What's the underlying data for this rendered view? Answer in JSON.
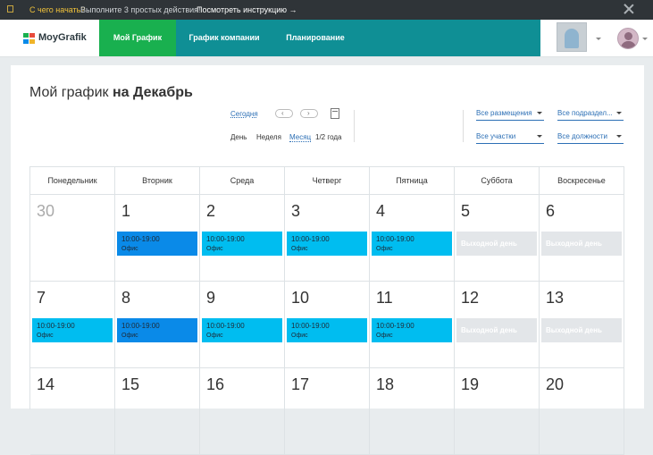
{
  "topbar": {
    "link": "С чего начать?",
    "text": "Выполните 3 простых действия!",
    "howto": "Посмотреть инструкцию →"
  },
  "navbar": {
    "logo": "MoyGrafik",
    "tabs": [
      {
        "label": "Мой График",
        "active": true
      },
      {
        "label": "График компании",
        "active": false
      },
      {
        "label": "Планирование",
        "active": false
      }
    ]
  },
  "page": {
    "title_prefix": "Мой график ",
    "title_month": "на Декабрь"
  },
  "controls": {
    "today": "Сегодня",
    "prev": "‹",
    "next": "›",
    "views": [
      {
        "label": "День",
        "active": false
      },
      {
        "label": "Неделя",
        "active": false
      },
      {
        "label": "Месяц",
        "active": true
      },
      {
        "label": "1/2 года",
        "active": false
      }
    ]
  },
  "filters": {
    "placements": "Все размещения",
    "departments": "Все подраздел...",
    "participants": "Все участки",
    "positions": "Все должности"
  },
  "calendar": {
    "weekdays": [
      "Понедельник",
      "Вторник",
      "Среда",
      "Четверг",
      "Пятница",
      "Суббота",
      "Воскресенье"
    ],
    "weeks": [
      [
        {
          "day": "30",
          "muted": true
        },
        {
          "day": "1",
          "shift": {
            "time": "10:00-19:00",
            "place": "Офис",
            "color": "#0a8ae8"
          }
        },
        {
          "day": "2",
          "shift": {
            "time": "10:00-19:00",
            "place": "Офис",
            "color": "#00bdf0"
          }
        },
        {
          "day": "3",
          "shift": {
            "time": "10:00-19:00",
            "place": "Офис",
            "color": "#00bdf0"
          }
        },
        {
          "day": "4",
          "shift": {
            "time": "10:00-19:00",
            "place": "Офис",
            "color": "#00bdf0"
          }
        },
        {
          "day": "5",
          "off": "Выходной день"
        },
        {
          "day": "6",
          "off": "Выходной день"
        }
      ],
      [
        {
          "day": "7",
          "shift": {
            "time": "10:00-19:00",
            "place": "Офис",
            "color": "#00bdf0"
          }
        },
        {
          "day": "8",
          "shift": {
            "time": "10:00-19:00",
            "place": "Офис",
            "color": "#0a8ae8"
          }
        },
        {
          "day": "9",
          "shift": {
            "time": "10:00-19:00",
            "place": "Офис",
            "color": "#00bdf0"
          }
        },
        {
          "day": "10",
          "shift": {
            "time": "10:00-19:00",
            "place": "Офис",
            "color": "#00bdf0"
          }
        },
        {
          "day": "11",
          "shift": {
            "time": "10:00-19:00",
            "place": "Офис",
            "color": "#00bdf0"
          }
        },
        {
          "day": "12",
          "off": "Выходной день"
        },
        {
          "day": "13",
          "off": "Выходной день"
        }
      ],
      [
        {
          "day": "14"
        },
        {
          "day": "15"
        },
        {
          "day": "16"
        },
        {
          "day": "17"
        },
        {
          "day": "18"
        },
        {
          "day": "19"
        },
        {
          "day": "20"
        }
      ]
    ]
  }
}
